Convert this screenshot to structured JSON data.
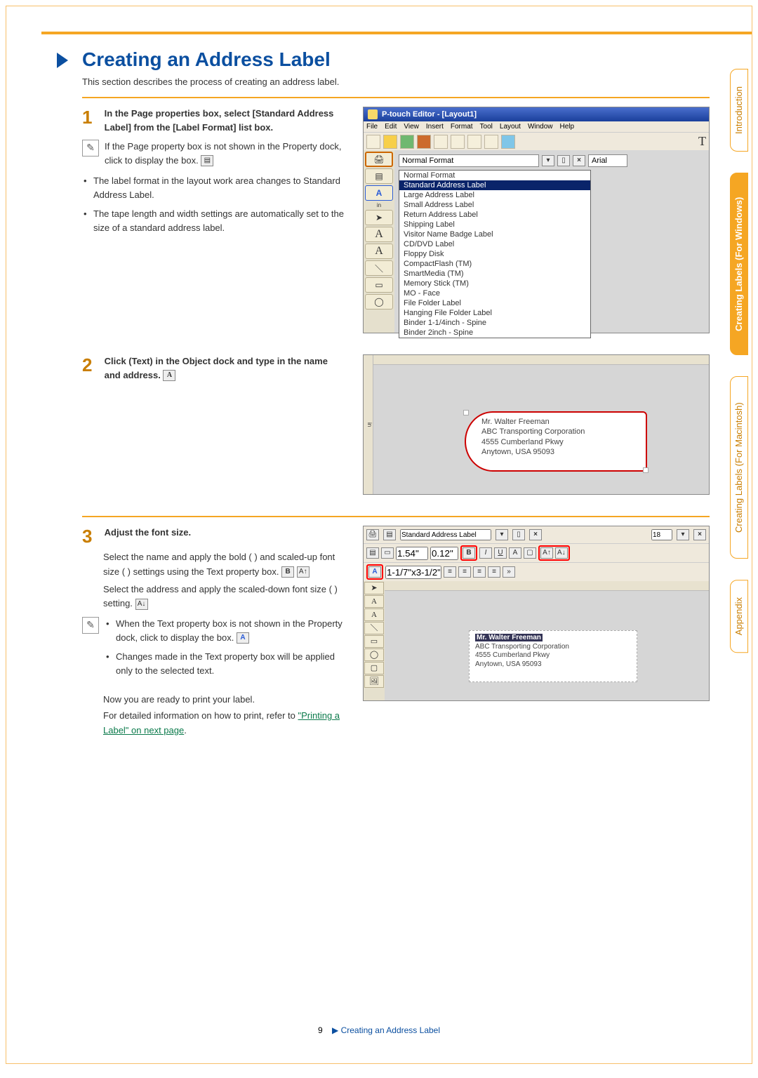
{
  "page": {
    "title": "Creating an Address Label",
    "subtitle": "This section describes the process of creating an address label.",
    "number": "9",
    "footer_label": "Creating an Address Label"
  },
  "step1": {
    "num": "1",
    "heading": "In the Page properties box, select [Standard Address Label] from the [Label Format] list box.",
    "note": "If the Page property box is not shown in the Property dock, click        to display the box.",
    "bullets": [
      "The label format in the layout work area changes to Standard Address Label.",
      "The tape length and width settings are automatically set to the size of a standard address label."
    ]
  },
  "step2": {
    "num": "2",
    "heading": "Click      (Text) in the Object dock and type in the name and address."
  },
  "step3": {
    "num": "3",
    "heading": "Adjust the font size.",
    "p1": "Select the name and apply the bold (     ) and scaled-up font size  (     ) settings using the Text property box.",
    "p2": "Select the address and apply the scaled-down font size (     ) setting.",
    "note_bullets": [
      "When the Text property box is not shown in the Property dock, click        to display the box.",
      "Changes made in the Text property box will be applied only to the selected text."
    ],
    "closing1": "Now you are ready to print your label.",
    "closing2a": "For detailed information on how to print, refer to ",
    "closing2b": "\"Printing a Label\" on next page",
    "closing2c": "."
  },
  "shot1": {
    "title": "P-touch Editor - [Layout1]",
    "menu": [
      "File",
      "Edit",
      "View",
      "Insert",
      "Format",
      "Tool",
      "Layout",
      "Window",
      "Help"
    ],
    "combo_value": "Normal Format",
    "font_value": "Arial",
    "dropdown": [
      "Normal Format",
      "Standard Address Label",
      "Large Address Label",
      "Small Address Label",
      "Return Address Label",
      "Shipping Label",
      "Visitor Name Badge Label",
      "CD/DVD Label",
      "Floppy Disk",
      "CompactFlash (TM)",
      "SmartMedia (TM)",
      "Memory Stick (TM)",
      "MO - Face",
      "File Folder Label",
      "Hanging File Folder Label",
      "Binder 1-1/4inch - Spine",
      "Binder 2inch - Spine"
    ],
    "side_label": "in"
  },
  "shot2": {
    "lines": [
      "Mr. Walter Freeman",
      "ABC Transporting Corporation",
      "4555 Cumberland Pkwy",
      "Anytown, USA 95093"
    ],
    "ruler": "in"
  },
  "shot3": {
    "format": "Standard Address Label",
    "size1": "1.54\"",
    "size2": "0.12\"",
    "fontsize": "18",
    "tape": "1-1/7\"x3-1/2\"",
    "lines": [
      "Mr. Walter Freeman",
      "ABC Transporting Corporation",
      "4555 Cumberland Pkwy",
      "Anytown, USA 95093"
    ]
  },
  "tabs": {
    "t1": "Introduction",
    "t2": "Creating Labels (For Windows)",
    "t3": "Creating Labels (For Macintosh)",
    "t4": "Appendix"
  }
}
